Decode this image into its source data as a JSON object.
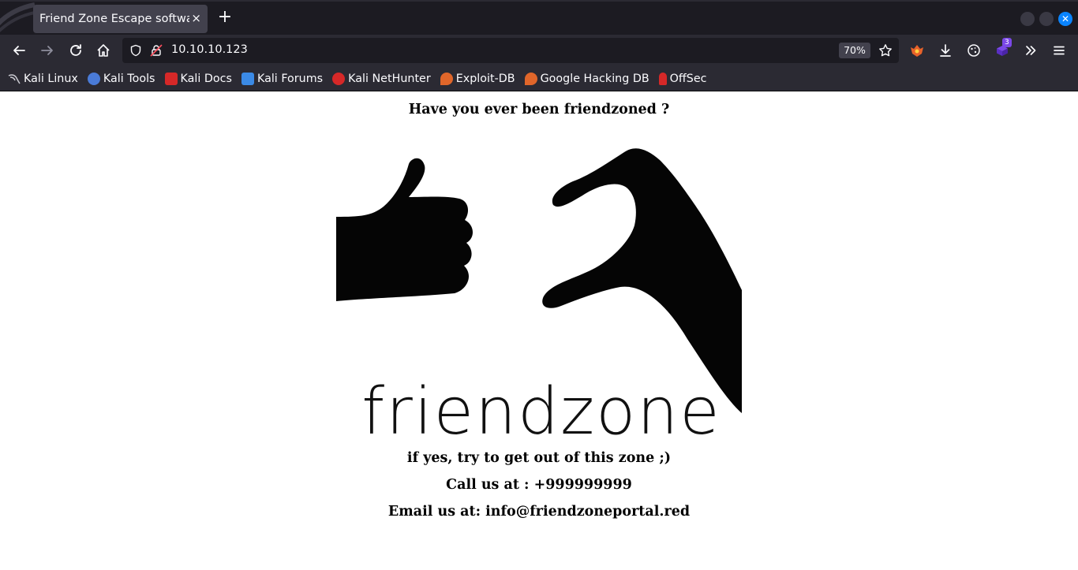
{
  "browser": {
    "tab": {
      "title": "Friend Zone Escape software",
      "close": "×"
    },
    "new_tab": "+",
    "url": "10.10.10.123",
    "zoom": "70%",
    "extension_badge": "3",
    "bookmarks": [
      {
        "label": "Kali Linux",
        "icon": "kali-dragon-icon",
        "color": "#c9c9d0"
      },
      {
        "label": "Kali Tools",
        "icon": "kali-tools-icon",
        "color": "#4a7bd8"
      },
      {
        "label": "Kali Docs",
        "icon": "kali-docs-icon",
        "color": "#d62828"
      },
      {
        "label": "Kali Forums",
        "icon": "kali-forums-icon",
        "color": "#3b8ae6"
      },
      {
        "label": "Kali NetHunter",
        "icon": "kali-nethunter-icon",
        "color": "#d62828"
      },
      {
        "label": "Exploit-DB",
        "icon": "exploit-db-icon",
        "color": "#e0662a"
      },
      {
        "label": "Google Hacking DB",
        "icon": "ghdb-icon",
        "color": "#e0662a"
      },
      {
        "label": "OffSec",
        "icon": "offsec-icon",
        "color": "#d62828"
      }
    ]
  },
  "content": {
    "heading": "Have you ever been friendzoned ?",
    "image_word": "friendzone",
    "line1": "if yes, try to get out of this zone ;)",
    "line2": "Call us at : +999999999",
    "line3": "Email us at: info@friendzoneportal.red"
  },
  "colors": {
    "tabstrip_bg": "#1c1b22",
    "toolbar_bg": "#2b2a33",
    "urlbar_bg": "#1c1b22",
    "tab_bg": "#42414d",
    "text_light": "#fbfbfe",
    "accent_blue": "#0a84ff"
  }
}
